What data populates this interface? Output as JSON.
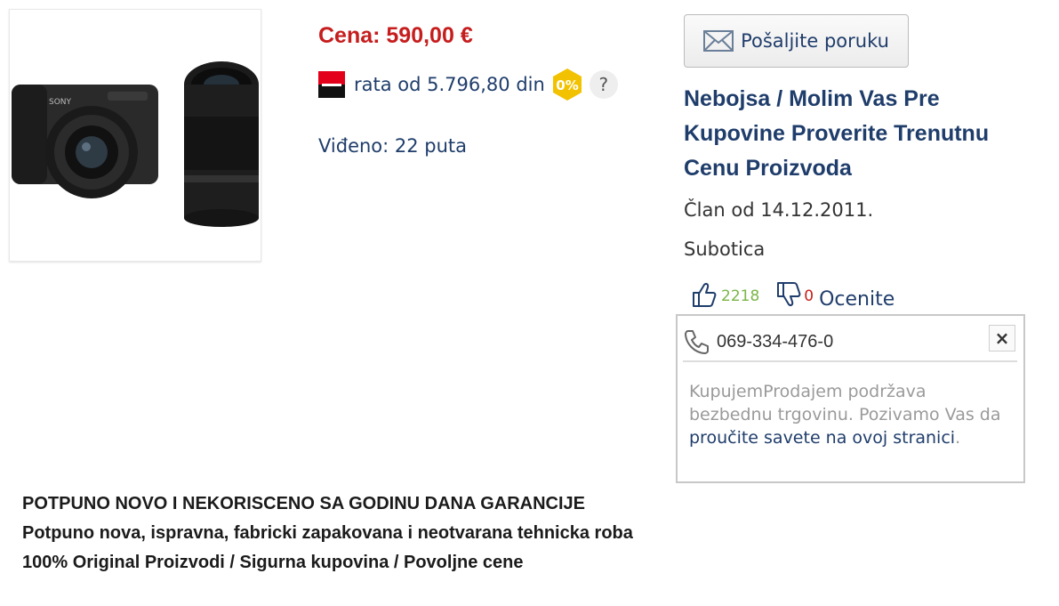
{
  "product": {
    "image_alt": "Sony camera with lenses"
  },
  "price": {
    "text": "Cena: 590,00 €"
  },
  "installment": {
    "text": "rata od 5.796,80 din",
    "badge": "0%",
    "help": "?"
  },
  "views": {
    "text": "Viđeno: 22 puta"
  },
  "message_button": {
    "label": "Pošaljite poruku"
  },
  "seller": {
    "name_line1": "Nebojsa / Molim Vas Pre",
    "name_line2": "Kupovine Proverite Trenutnu",
    "name_line3": "Cenu Proizvoda",
    "member_since": "Član od 14.12.2011.",
    "city": "Subotica"
  },
  "rating": {
    "positive": "2218",
    "negative": "0",
    "rate_label": "Ocenite"
  },
  "phone_box": {
    "number": "069-334-476-0",
    "close": "×",
    "note_prefix": "KupujemProdajem podržava bezbednu trgovinu. Pozivamo Vas da ",
    "note_link": "proučite savete na ovoj stranici",
    "note_suffix": "."
  },
  "description": {
    "line1": "POTPUNO NOVO I NEKORISCENO SA GODINU DANA GARANCIJE",
    "line2": "Potpuno nova, ispravna, fabricki zapakovana i neotvarana tehnicka roba",
    "line3": "100% Original Proizvodi / Sigurna kupovina / Povoljne cene"
  },
  "colors": {
    "price_red": "#c61d1d",
    "link_blue": "#1f3d6b",
    "positive_green": "#7ab548",
    "badge_yellow": "#f2c200"
  }
}
